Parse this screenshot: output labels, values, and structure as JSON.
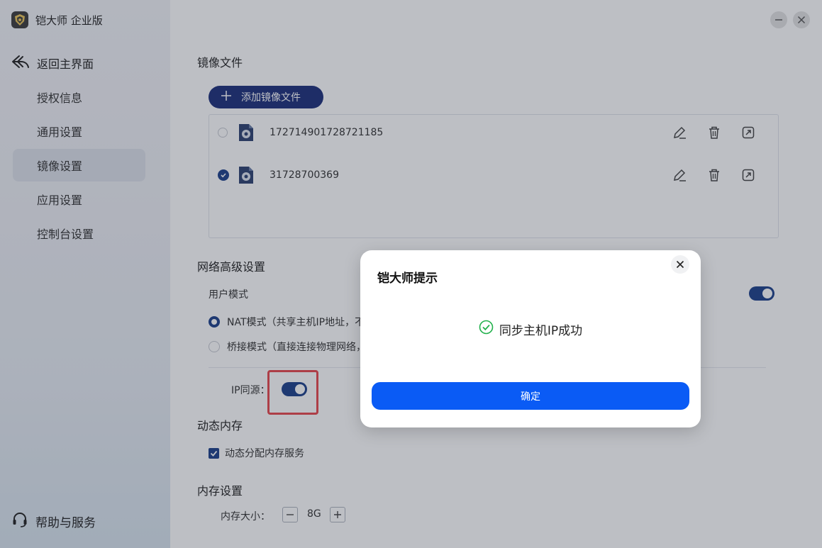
{
  "app": {
    "title": "铠大师 企业版"
  },
  "sidebar": {
    "back_label": "返回主界面",
    "items": [
      {
        "label": "授权信息"
      },
      {
        "label": "通用设置"
      },
      {
        "label": "镜像设置",
        "active": true
      },
      {
        "label": "应用设置"
      },
      {
        "label": "控制台设置"
      }
    ],
    "help_label": "帮助与服务"
  },
  "main": {
    "image_section": {
      "title": "镜像文件",
      "add_button": "添加镜像文件",
      "files": [
        {
          "name": "172714901728721185",
          "selected": false
        },
        {
          "name": "31728700369",
          "selected": true
        }
      ]
    },
    "network_section": {
      "title": "网络高级设置",
      "user_mode_label": "用户模式",
      "user_mode_enabled": true,
      "nat_option": "NAT模式（共享主机IP地址，不",
      "bridge_option": "桥接模式（直接连接物理网络，",
      "ip_sync_label": "IP同源：",
      "ip_sync_enabled": true
    },
    "dynamic_memory": {
      "title": "动态内存",
      "checkbox_label": "动态分配内存服务",
      "checked": true
    },
    "memory_settings": {
      "title": "内存设置",
      "size_label": "内存大小：",
      "size_value": "8G"
    }
  },
  "dialog": {
    "title": "铠大师提示",
    "message": "同步主机IP成功",
    "ok_label": "确定"
  },
  "colors": {
    "accent": "#1c3f8a",
    "primary_button": "#0a5bf5",
    "success": "#22b14c",
    "highlight": "#e8474c"
  }
}
